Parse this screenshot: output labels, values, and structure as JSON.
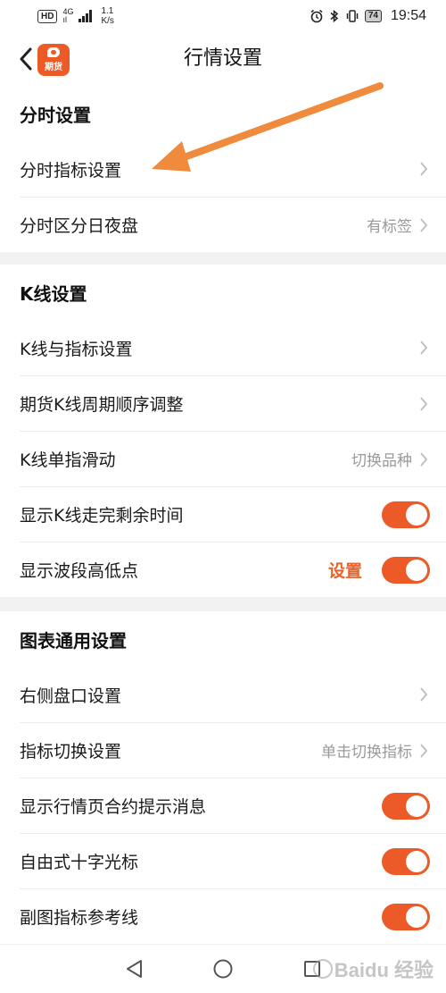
{
  "status_bar": {
    "hd": "HD",
    "network": "4G",
    "network_sub": "ıl",
    "speed_value": "1.1",
    "speed_unit": "K/s",
    "battery": "74",
    "time": "19:54"
  },
  "header": {
    "title": "行情设置",
    "logo_text": "期货"
  },
  "sections": [
    {
      "title": "分时设置",
      "rows": [
        {
          "label": "分时指标设置",
          "value": "",
          "control": "chevron"
        },
        {
          "label": "分时区分日夜盘",
          "value": "有标签",
          "control": "chevron"
        }
      ]
    },
    {
      "title": "K线设置",
      "rows": [
        {
          "label": "K线与指标设置",
          "value": "",
          "control": "chevron"
        },
        {
          "label": "期货K线周期顺序调整",
          "value": "",
          "control": "chevron"
        },
        {
          "label": "K线单指滑动",
          "value": "切换品种",
          "control": "chevron"
        },
        {
          "label": "显示K线走完剩余时间",
          "value": "",
          "control": "toggle",
          "on": true
        },
        {
          "label": "显示波段高低点",
          "value": "设置",
          "control": "toggle",
          "on": true
        }
      ]
    },
    {
      "title": "图表通用设置",
      "rows": [
        {
          "label": "右侧盘口设置",
          "value": "",
          "control": "chevron"
        },
        {
          "label": "指标切换设置",
          "value": "单击切换指标",
          "control": "chevron"
        },
        {
          "label": "显示行情页合约提示消息",
          "value": "",
          "control": "toggle",
          "on": true
        },
        {
          "label": "自由式十字光标",
          "value": "",
          "control": "toggle",
          "on": true
        },
        {
          "label": "副图指标参考线",
          "value": "",
          "control": "toggle",
          "on": true
        }
      ]
    }
  ],
  "watermark": "Baidu 经验",
  "colors": {
    "accent": "#ec5a27",
    "arrow": "#f08a3c",
    "background": "#f2f2f2",
    "secondary_text": "#9a9a9a"
  }
}
